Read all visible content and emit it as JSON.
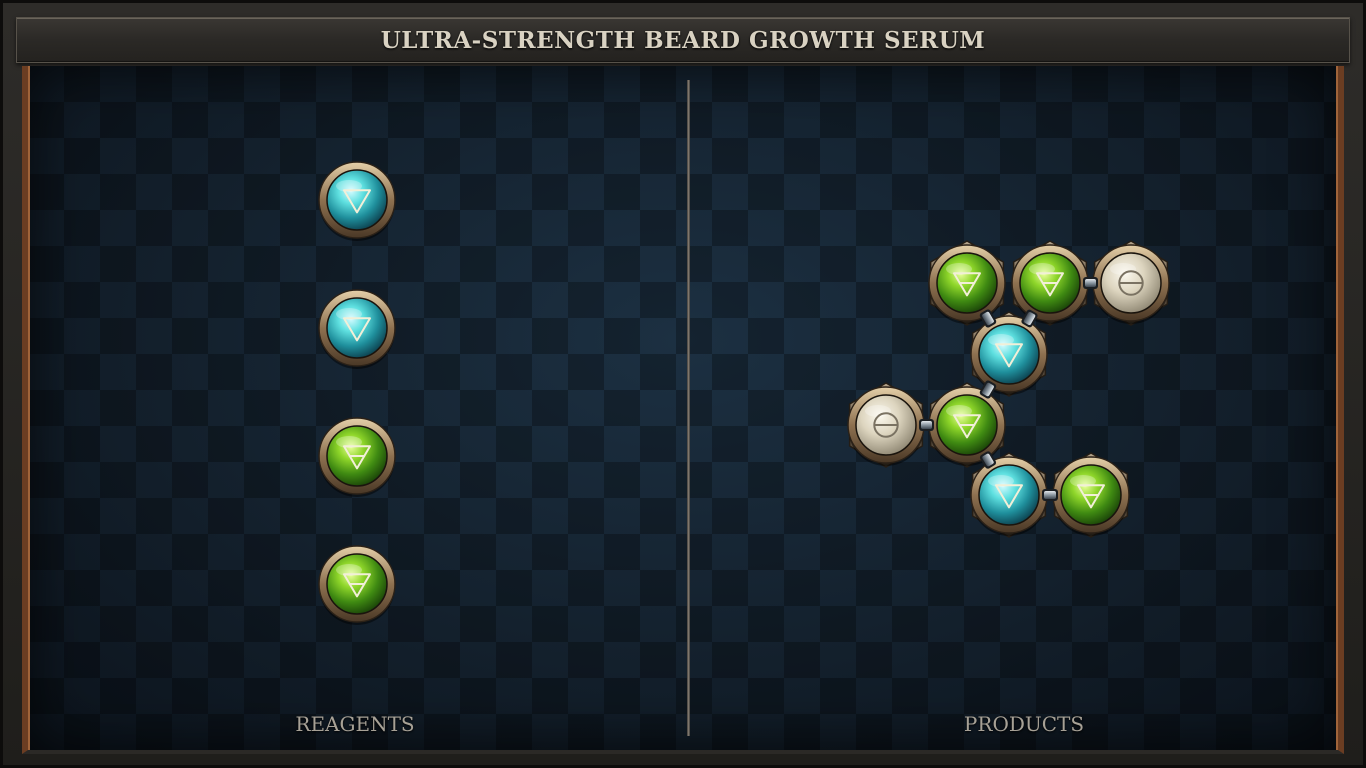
{
  "title": "ULTRA-STRENGTH BEARD GROWTH SERUM",
  "panels": {
    "reagents_label": "REAGENTS",
    "products_label": "PRODUCTS"
  },
  "symbols": {
    "water": "water-symbol-icon",
    "earth": "earth-symbol-icon",
    "salt": "salt-symbol-icon"
  },
  "reagents": [
    {
      "element": "water"
    },
    {
      "element": "water"
    },
    {
      "element": "earth"
    },
    {
      "element": "earth"
    }
  ],
  "product": {
    "atoms": [
      {
        "id": "a1",
        "element": "earth"
      },
      {
        "id": "a2",
        "element": "earth"
      },
      {
        "id": "a3",
        "element": "salt"
      },
      {
        "id": "a4",
        "element": "water"
      },
      {
        "id": "a5",
        "element": "salt"
      },
      {
        "id": "a6",
        "element": "earth"
      },
      {
        "id": "a7",
        "element": "water"
      },
      {
        "id": "a8",
        "element": "earth"
      }
    ],
    "bonds": [
      [
        "a1",
        "a4"
      ],
      [
        "a2",
        "a4"
      ],
      [
        "a2",
        "a3"
      ],
      [
        "a4",
        "a6"
      ],
      [
        "a5",
        "a6"
      ],
      [
        "a6",
        "a7"
      ],
      [
        "a7",
        "a8"
      ]
    ]
  },
  "colors": {
    "water": "#33c0c8",
    "earth": "#7ccb1e",
    "salt": "#ddd6c2",
    "bronze": "#9c8466",
    "symbol": "#f2efd8"
  }
}
